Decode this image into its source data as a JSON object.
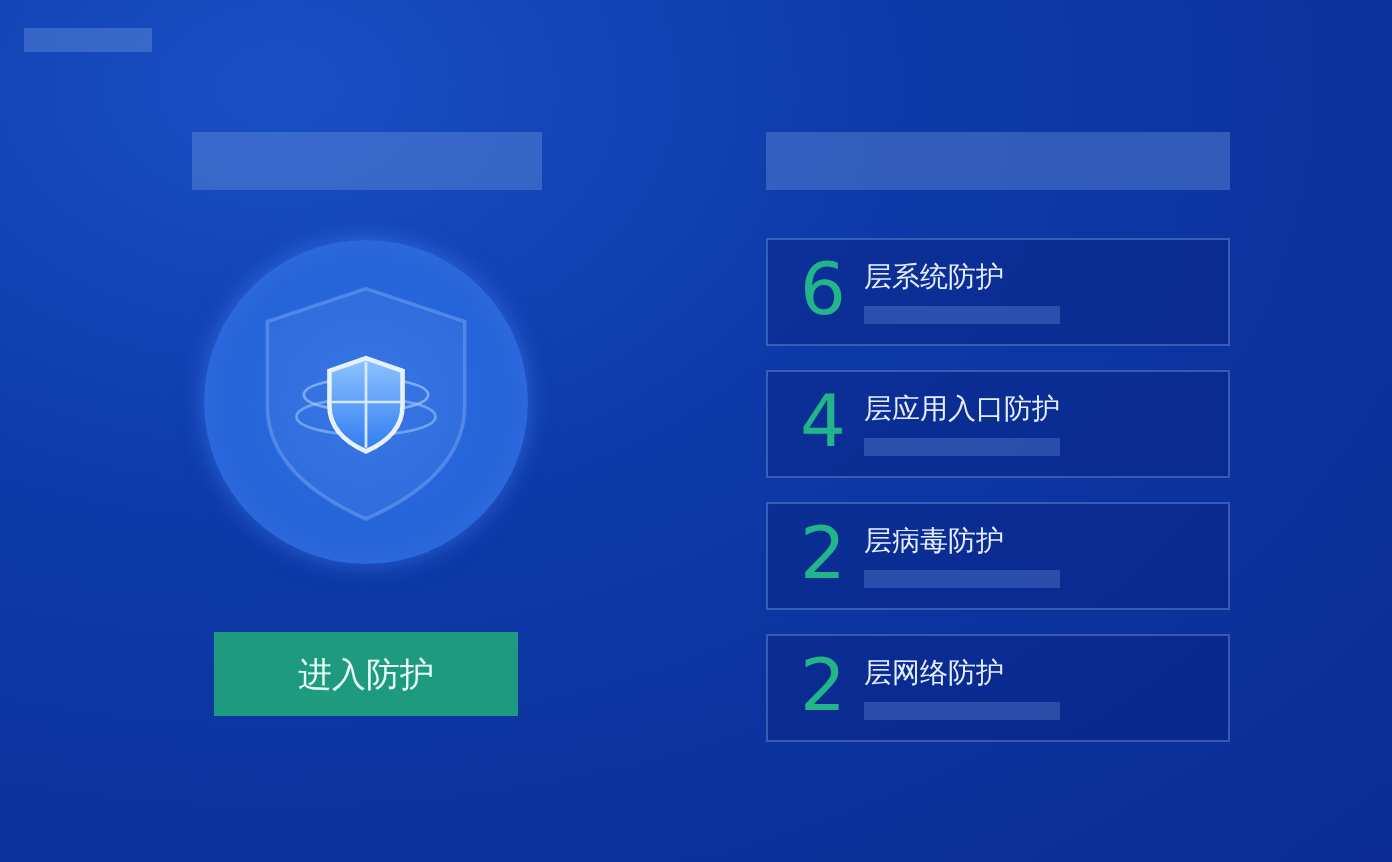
{
  "action_button": {
    "label": "进入防护"
  },
  "layers": [
    {
      "count": "6",
      "label": "层系统防护"
    },
    {
      "count": "4",
      "label": "层应用入口防护"
    },
    {
      "count": "2",
      "label": "层病毒防护"
    },
    {
      "count": "2",
      "label": "层网络防护"
    }
  ]
}
